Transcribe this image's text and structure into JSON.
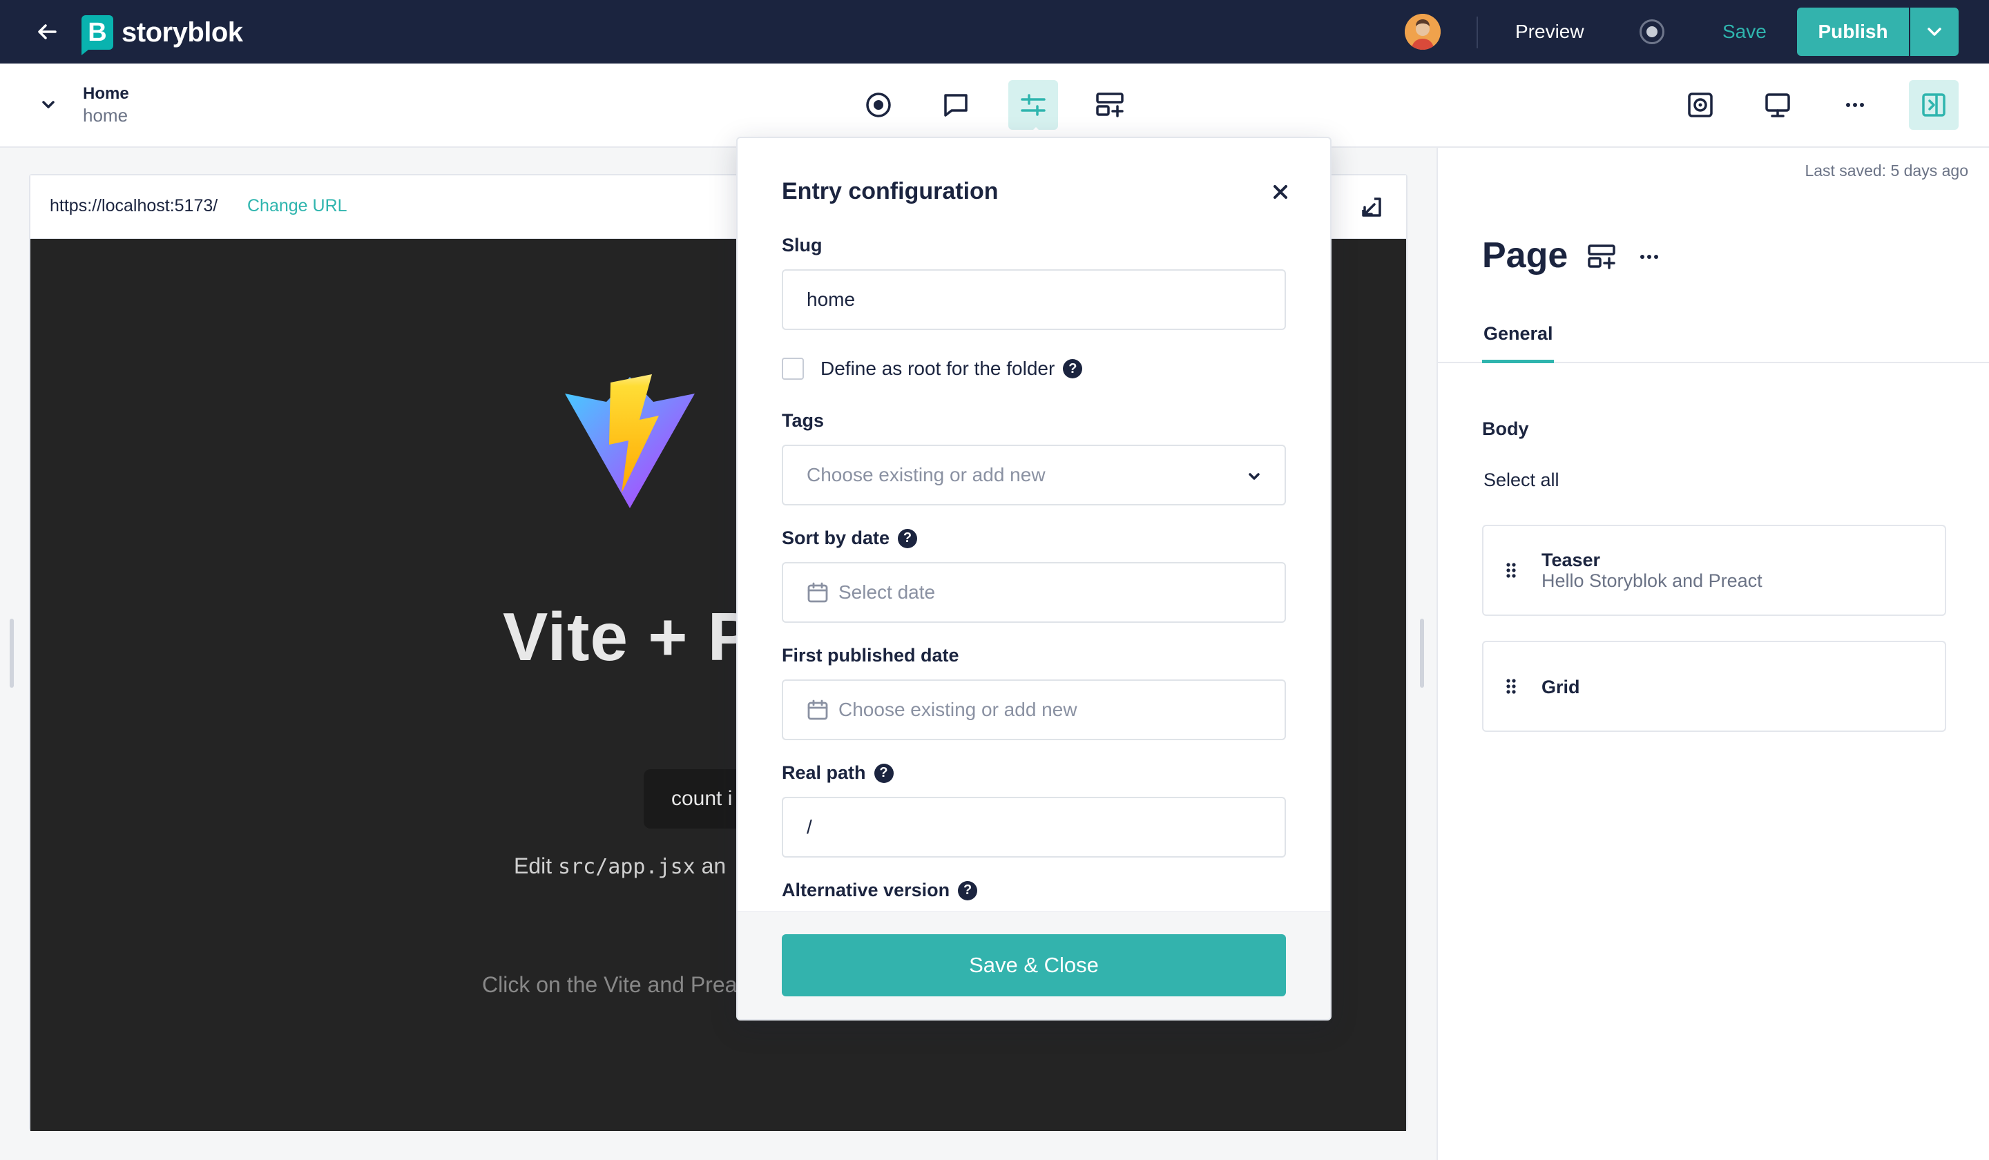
{
  "topbar": {
    "logo_letter": "B",
    "logo_text": "storyblok",
    "preview_label": "Preview",
    "save_label": "Save",
    "publish_label": "Publish"
  },
  "entry": {
    "title": "Home",
    "slug": "home"
  },
  "preview": {
    "url": "https://localhost:5173/",
    "change_url_label": "Change URL",
    "app": {
      "hero_title": "Vite + P",
      "count_label": "count i",
      "edit_prefix": "Edit ",
      "edit_code": "src/app.jsx",
      "edit_suffix": " an",
      "click_text": "Click on the Vite and Prea"
    }
  },
  "sidebar": {
    "last_saved": "Last saved: 5 days ago",
    "page_title": "Page",
    "tab_general": "General",
    "body_label": "Body",
    "select_all": "Select all",
    "blocks": [
      {
        "name": "Teaser",
        "subtitle": "Hello Storyblok and Preact"
      },
      {
        "name": "Grid",
        "subtitle": ""
      }
    ]
  },
  "modal": {
    "title": "Entry configuration",
    "slug_label": "Slug",
    "slug_value": "home",
    "root_checkbox_label": "Define as root for the folder",
    "tags_label": "Tags",
    "tags_placeholder": "Choose existing or add new",
    "sort_by_date_label": "Sort by date",
    "sort_by_date_placeholder": "Select date",
    "first_published_label": "First published date",
    "first_published_placeholder": "Choose existing or add new",
    "real_path_label": "Real path",
    "real_path_value": "/",
    "alternative_version_label": "Alternative version",
    "help_glyph": "?",
    "save_close_label": "Save & Close"
  },
  "colors": {
    "brand_teal": "#33b3ad",
    "navy": "#1b243f",
    "active_tool_bg": "#d6f1ef"
  }
}
